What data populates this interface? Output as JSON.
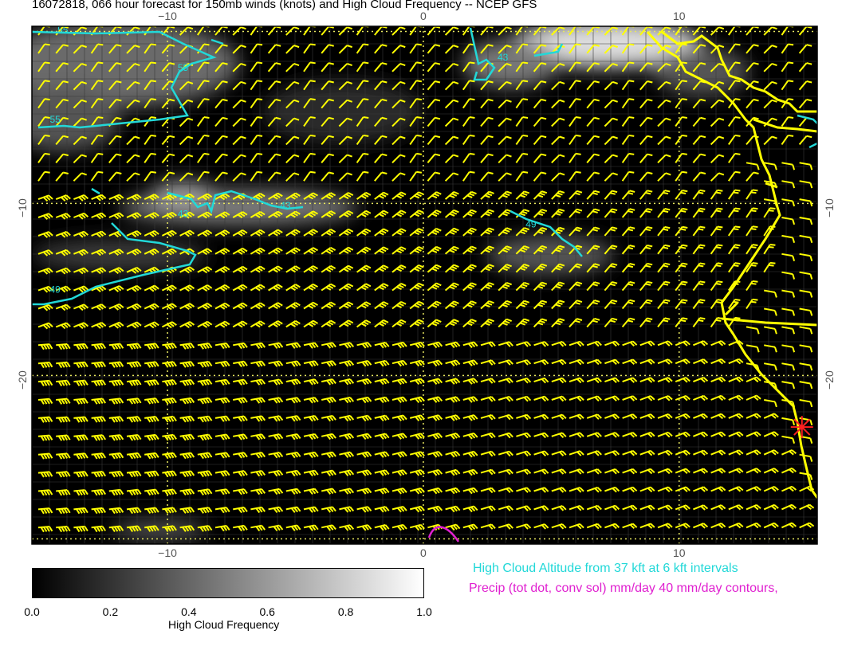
{
  "title": "16072818, 066 hour forecast for 150mb winds (knots) and High Cloud Frequency -- NCEP GFS",
  "axes": {
    "lon_ticks": [
      {
        "lon": -10,
        "label": "−10"
      },
      {
        "lon": 0,
        "label": "0"
      },
      {
        "lon": 10,
        "label": "10"
      }
    ],
    "lat_ticks": [
      {
        "lat": -10,
        "label": "−10"
      },
      {
        "lat": -20,
        "label": "−20"
      }
    ],
    "lon_range": [
      -15.3,
      15.4
    ],
    "lat_range": [
      -29.8,
      0.3
    ]
  },
  "cloud_altitude_contour_labels": [
    {
      "label": "55",
      "lon": -14.3,
      "lat": -0.1
    },
    {
      "label": "55",
      "lon": -9.6,
      "lat": -2.3
    },
    {
      "label": "55",
      "lon": -14.6,
      "lat": -5.3
    },
    {
      "label": "43",
      "lon": -9.6,
      "lat": -10.8
    },
    {
      "label": "43",
      "lon": -5.6,
      "lat": -10.3
    },
    {
      "label": "49",
      "lon": 4.0,
      "lat": -11.4
    },
    {
      "label": "49",
      "lon": -14.6,
      "lat": -15.2
    },
    {
      "label": "43",
      "lon": 2.9,
      "lat": -1.7
    }
  ],
  "marker": {
    "name": "red-star",
    "lon": 14.8,
    "lat": -23.0,
    "color": "#ff2020"
  },
  "colorbar": {
    "ticks": [
      "0.0",
      "0.2",
      "0.4",
      "0.6",
      "0.8",
      "1.0"
    ],
    "label": "High Cloud Frequency",
    "range": [
      0.0,
      1.0
    ]
  },
  "legend_notes": {
    "cloud_altitude": "High Cloud Altitude from 37 kft at 6 kft intervals",
    "precip": "Precip (tot dot, conv sol) mm/day 40 mm/day contours,"
  },
  "colors": {
    "barbs": "#ffff00",
    "coast": "#ffff00",
    "cloud_contour": "#22d8d8",
    "precip_contour": "#e020d0",
    "background": "#000000",
    "gridlines_dotted": "#e8e860"
  }
}
